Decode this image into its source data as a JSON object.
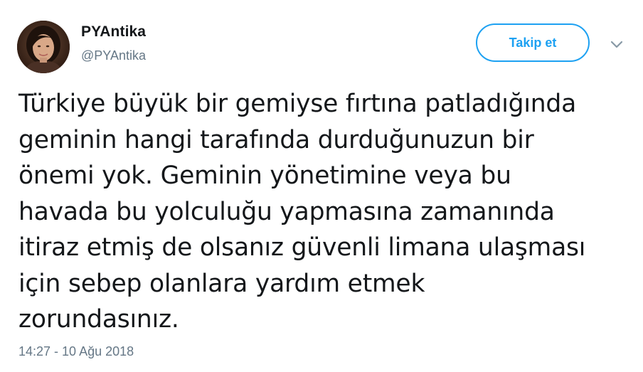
{
  "author": {
    "display_name": "PYAntika",
    "handle": "@PYAntika",
    "avatar_icon": "profile-photo"
  },
  "actions": {
    "follow_label": "Takip et",
    "more_icon": "chevron-down-icon"
  },
  "tweet": {
    "text": "Türkiye büyük bir gemiyse fırtına patladığında\ngeminin hangi tarafında durduğunuzun bir\nönemi yok. Geminin yönetimine veya bu\nhavada bu yolculuğu yapmasına zamanında\nitiraz etmiş de olsanız güvenli limana ulaşması\niçin sebep olanlara yardım etmek\nzorundasınız.",
    "timestamp": "14:27 - 10 Ağu 2018"
  },
  "colors": {
    "accent": "#1da1f2",
    "text_primary": "#14171a",
    "text_secondary": "#657786"
  }
}
